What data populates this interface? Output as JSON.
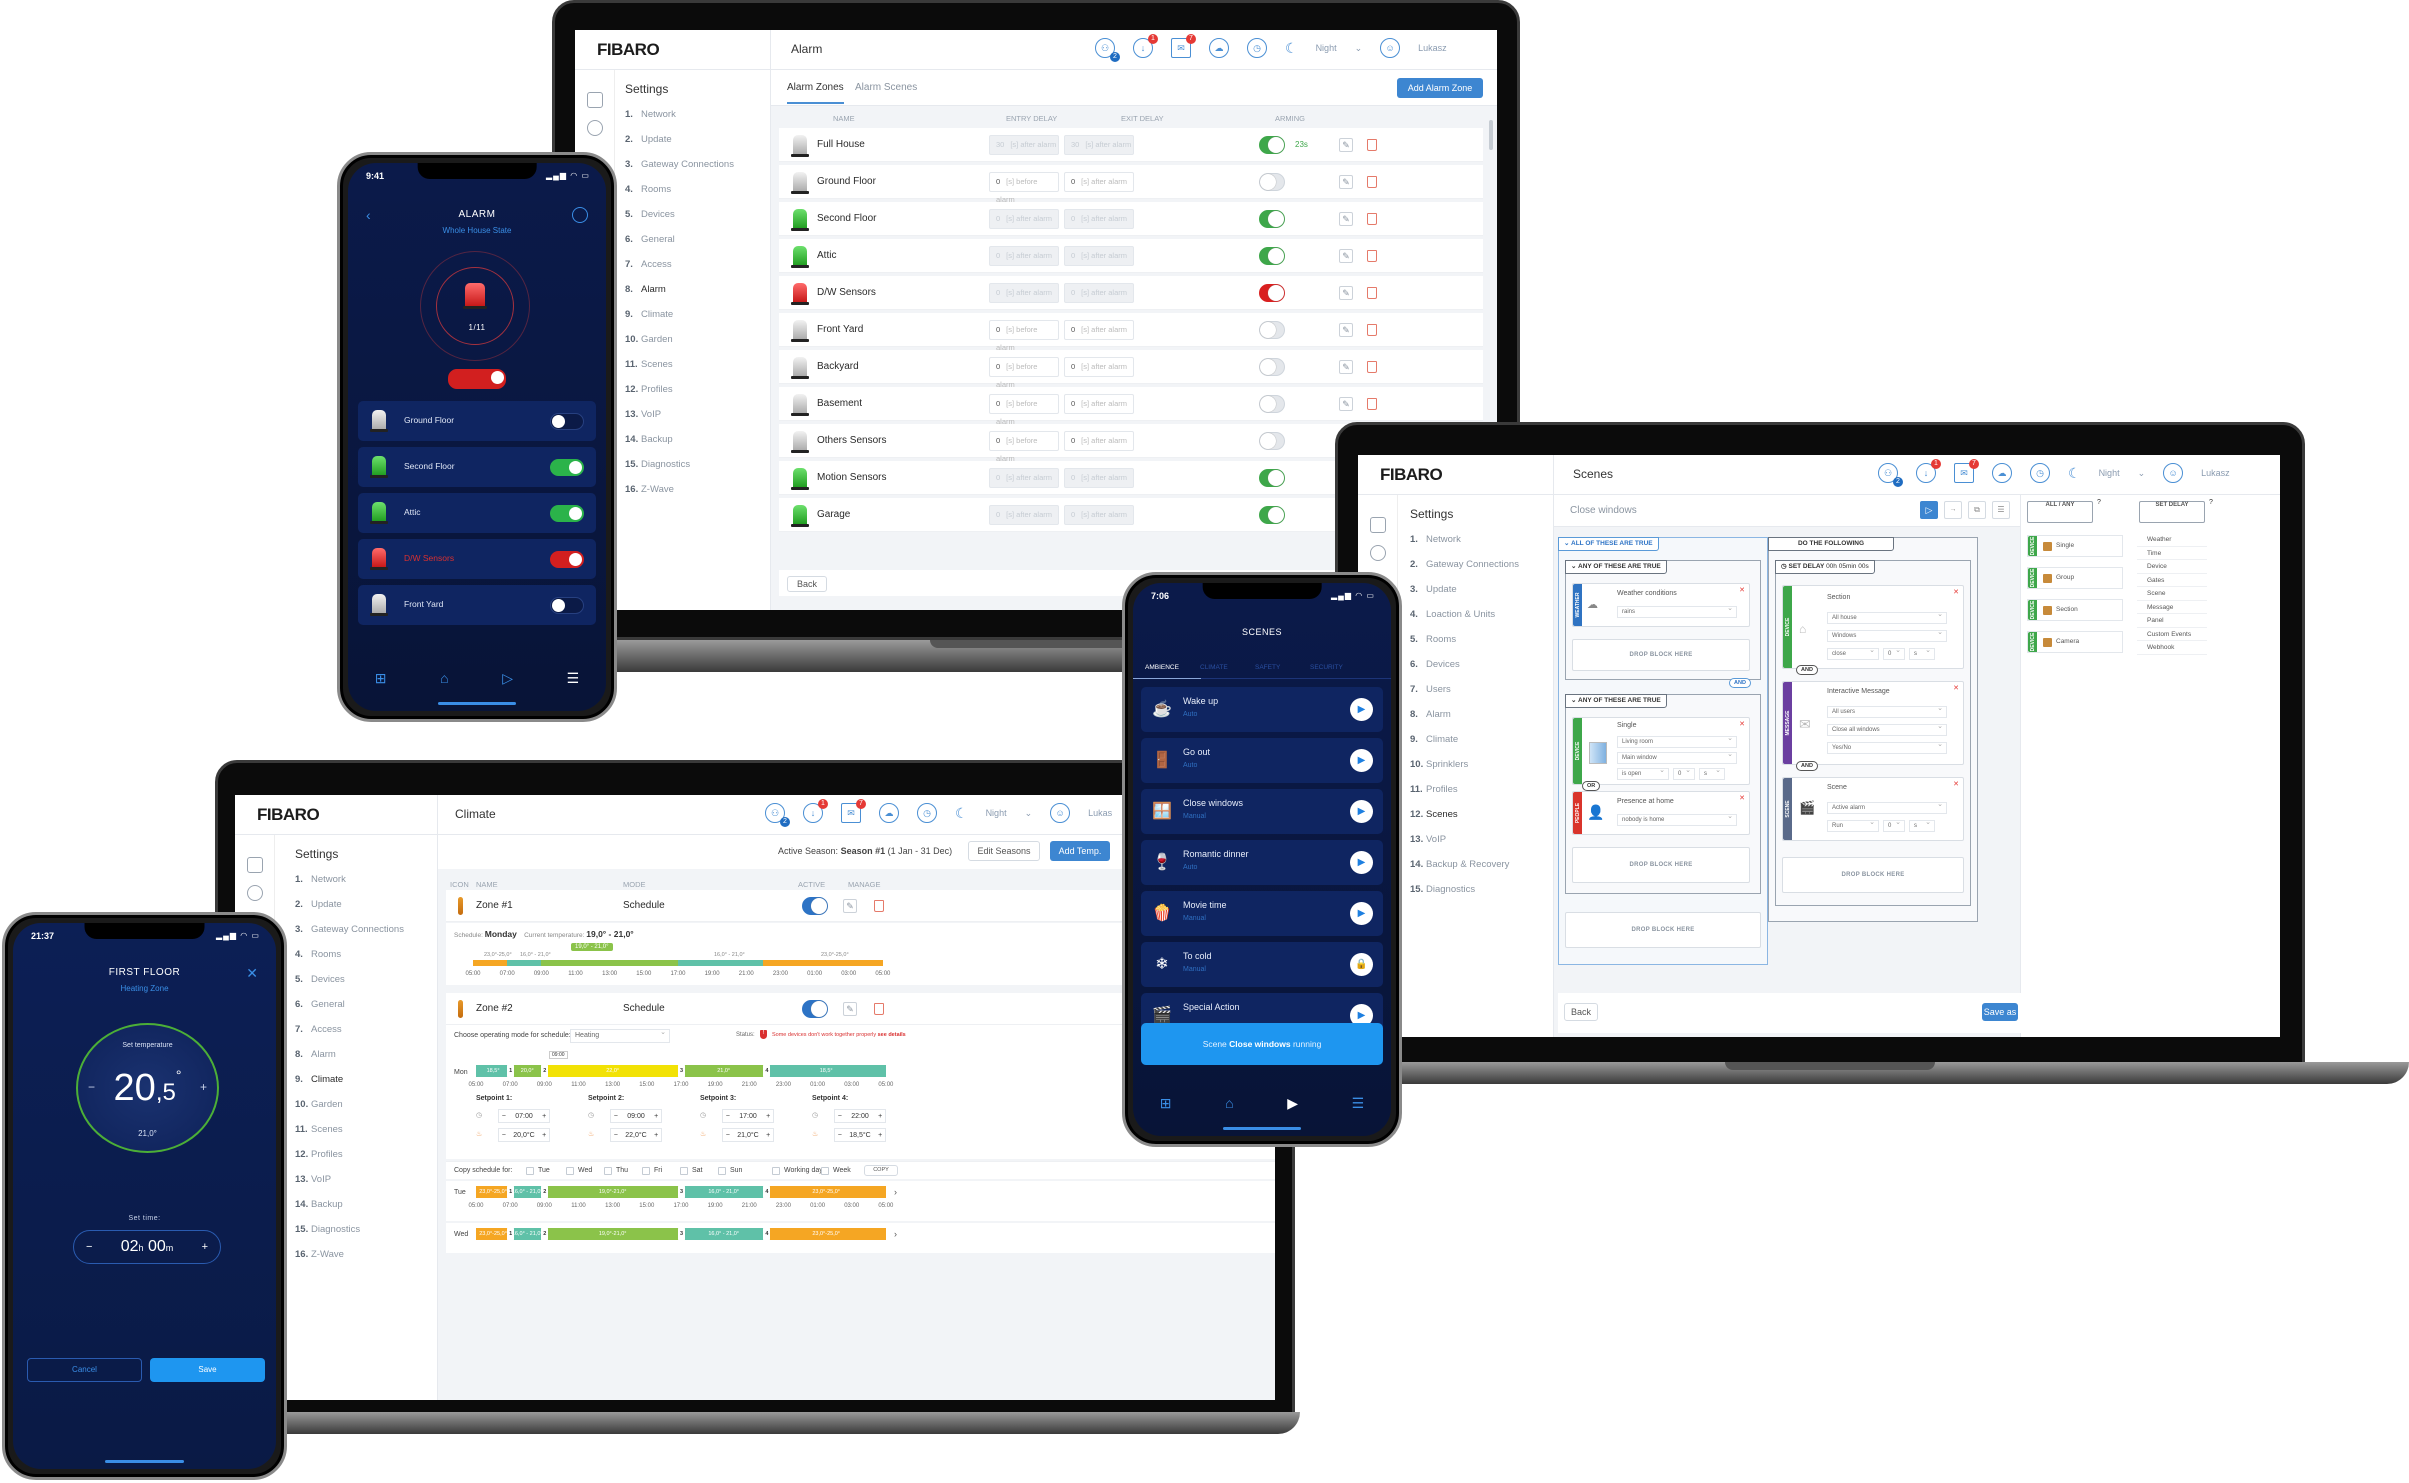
{
  "alarm_app": {
    "brand": "FIBARO",
    "page_title": "Alarm",
    "topbar": {
      "users_badge": "2",
      "updates_badge": "1",
      "messages_badge": "7",
      "mode_label": "Night",
      "user_name": "Lukasz"
    },
    "sidebar": {
      "title": "Settings",
      "items": [
        {
          "num": "1.",
          "label": "Network"
        },
        {
          "num": "2.",
          "label": "Update"
        },
        {
          "num": "3.",
          "label": "Gateway Connections"
        },
        {
          "num": "4.",
          "label": "Rooms"
        },
        {
          "num": "5.",
          "label": "Devices"
        },
        {
          "num": "6.",
          "label": "General"
        },
        {
          "num": "7.",
          "label": "Access"
        },
        {
          "num": "8.",
          "label": "Alarm",
          "active": true
        },
        {
          "num": "9.",
          "label": "Climate"
        },
        {
          "num": "10.",
          "label": "Garden"
        },
        {
          "num": "11.",
          "label": "Scenes"
        },
        {
          "num": "12.",
          "label": "Profiles"
        },
        {
          "num": "13.",
          "label": "VoIP"
        },
        {
          "num": "14.",
          "label": "Backup"
        },
        {
          "num": "15.",
          "label": "Diagnostics"
        },
        {
          "num": "16.",
          "label": "Z-Wave"
        }
      ]
    },
    "tabs": [
      "Alarm Zones",
      "Alarm Scenes"
    ],
    "add_button": "Add Alarm Zone",
    "columns": {
      "name": "NAME",
      "entry": "ENTRY DELAY",
      "exit": "EXIT DELAY",
      "arming": "ARMING"
    },
    "rows": [
      {
        "name": "Full House",
        "siren": "grey",
        "entry_value": "30",
        "entry_unit": "[s] after alarm",
        "exit_value": "30",
        "exit_unit": "[s] after alarm",
        "armed": "on",
        "disabled": true,
        "countdown": "23s"
      },
      {
        "name": "Ground Floor",
        "siren": "grey",
        "entry_value": "0",
        "entry_unit": "[s] before alarm",
        "exit_value": "0",
        "exit_unit": "[s] after alarm",
        "armed": "off",
        "disabled": false
      },
      {
        "name": "Second Floor",
        "siren": "green",
        "entry_value": "0",
        "entry_unit": "[s] after alarm",
        "exit_value": "0",
        "exit_unit": "[s] after alarm",
        "armed": "on",
        "disabled": true
      },
      {
        "name": "Attic",
        "siren": "green",
        "entry_value": "0",
        "entry_unit": "[s] after alarm",
        "exit_value": "0",
        "exit_unit": "[s] after alarm",
        "armed": "on",
        "disabled": true
      },
      {
        "name": "D/W Sensors",
        "siren": "red",
        "entry_value": "0",
        "entry_unit": "[s] after alarm",
        "exit_value": "0",
        "exit_unit": "[s] after alarm",
        "armed": "red",
        "disabled": true
      },
      {
        "name": "Front Yard",
        "siren": "grey",
        "entry_value": "0",
        "entry_unit": "[s] before alarm",
        "exit_value": "0",
        "exit_unit": "[s] after alarm",
        "armed": "off",
        "disabled": false
      },
      {
        "name": "Backyard",
        "siren": "grey",
        "entry_value": "0",
        "entry_unit": "[s] before alarm",
        "exit_value": "0",
        "exit_unit": "[s] after alarm",
        "armed": "off",
        "disabled": false
      },
      {
        "name": "Basement",
        "siren": "grey",
        "entry_value": "0",
        "entry_unit": "[s] before alarm",
        "exit_value": "0",
        "exit_unit": "[s] after alarm",
        "armed": "off",
        "disabled": false
      },
      {
        "name": "Others Sensors",
        "siren": "grey",
        "entry_value": "0",
        "entry_unit": "[s] before alarm",
        "exit_value": "0",
        "exit_unit": "[s] after alarm",
        "armed": "off",
        "disabled": false
      },
      {
        "name": "Motion Sensors",
        "siren": "green",
        "entry_value": "0",
        "entry_unit": "[s] after alarm",
        "exit_value": "0",
        "exit_unit": "[s] after alarm",
        "armed": "on",
        "disabled": true
      },
      {
        "name": "Garage",
        "siren": "green",
        "entry_value": "0",
        "entry_unit": "[s] after alarm",
        "exit_value": "0",
        "exit_unit": "[s] after alarm",
        "armed": "on",
        "disabled": true
      }
    ],
    "back_button": "Back"
  },
  "alarm_phone": {
    "time": "9:41",
    "title": "ALARM",
    "subtitle": "Whole House State",
    "state_count": "1/11",
    "zones": [
      {
        "name": "Ground Floor",
        "siren": "grey",
        "state": "off"
      },
      {
        "name": "Second Floor",
        "siren": "green",
        "state": "on"
      },
      {
        "name": "Attic",
        "siren": "green",
        "state": "on"
      },
      {
        "name": "D/W Sensors",
        "siren": "red",
        "state": "red"
      },
      {
        "name": "Front Yard",
        "siren": "grey",
        "state": "off"
      }
    ]
  },
  "scenes_app": {
    "brand": "FIBARO",
    "page_title": "Scenes",
    "topbar": {
      "users_badge": "2",
      "updates_badge": "1",
      "messages_badge": "7",
      "mode_label": "Night",
      "user_name": "Lukasz"
    },
    "sidebar": {
      "title": "Settings",
      "items": [
        {
          "num": "1.",
          "label": "Network"
        },
        {
          "num": "2.",
          "label": "Gateway Connections"
        },
        {
          "num": "3.",
          "label": "Update"
        },
        {
          "num": "4.",
          "label": "Loaction & Units"
        },
        {
          "num": "5.",
          "label": "Rooms"
        },
        {
          "num": "6.",
          "label": "Devices"
        },
        {
          "num": "7.",
          "label": "Users"
        },
        {
          "num": "8.",
          "label": "Alarm"
        },
        {
          "num": "9.",
          "label": "Climate"
        },
        {
          "num": "10.",
          "label": "Sprinklers"
        },
        {
          "num": "11.",
          "label": "Profiles"
        },
        {
          "num": "12.",
          "label": "Scenes",
          "active": true
        },
        {
          "num": "13.",
          "label": "VoIP"
        },
        {
          "num": "14.",
          "label": "Backup & Recovery"
        },
        {
          "num": "15.",
          "label": "Diagnostics"
        }
      ]
    },
    "scene_name": "Close windows",
    "conditions": {
      "header": "ALL OF THESE ARE TRUE",
      "group1_header": "ANY OF THESE ARE TRUE",
      "weather_strip": "WEATHER",
      "weather_title": "Weather conditions",
      "weather_value": "rains",
      "group2_header": "ANY OF THESE ARE TRUE",
      "device_strip": "DEVICE",
      "single_title": "Single",
      "single_room": "Living room",
      "single_device": "Main window",
      "single_state": "is open",
      "single_num": "0",
      "single_unit": "s",
      "people_strip": "PEOPLE",
      "presence_title": "Presence at home",
      "presence_value": "nobody is home",
      "or_label": "OR",
      "and_label": "AND",
      "drop_label": "DROP BLOCK HERE"
    },
    "actions": {
      "header": "DO THE FOLLOWING",
      "delay_label": "SET DELAY",
      "delay_value": "00h 05min 00s",
      "device_strip": "DEVICE",
      "section_title": "Section",
      "section_area": "All house",
      "section_device": "Windows",
      "section_action": "close",
      "section_num": "0",
      "section_unit": "s",
      "message_strip": "MESSAGE",
      "message_title": "Interactive Message",
      "message_to": "All users",
      "message_text": "Close all windows",
      "message_type": "Yes/No",
      "scene_strip": "SCENE",
      "scene_title": "Scene",
      "scene_target": "Active alarm",
      "scene_action": "Run",
      "scene_num": "0",
      "scene_unit": "s",
      "and_label": "AND",
      "drop_label": "DROP BLOCK HERE"
    },
    "palette": {
      "all_any": "ALL / ANY",
      "set_delay": "SET DELAY",
      "help": "?",
      "devices": [
        {
          "strip": "DEVICE",
          "label": "Single"
        },
        {
          "strip": "DEVICE",
          "label": "Group"
        },
        {
          "strip": "DEVICE",
          "label": "Section"
        },
        {
          "strip": "DEVICE",
          "label": "Camera"
        }
      ],
      "categories": [
        "Weather",
        "Time",
        "Device",
        "Gates",
        "Scene",
        "Message",
        "Panel",
        "Custom Events",
        "Webhook"
      ]
    },
    "back_button": "Back",
    "save_button": "Save as"
  },
  "scenes_phone": {
    "time": "7:06",
    "title": "SCENES",
    "tabs": [
      "AMBIENCE",
      "CLIMATE",
      "SAFETY",
      "SECURITY"
    ],
    "scenes": [
      {
        "name": "Wake up",
        "mode": "Auto",
        "icon": "☕",
        "action": "play"
      },
      {
        "name": "Go out",
        "mode": "Auto",
        "icon": "🚪",
        "action": "play"
      },
      {
        "name": "Close windows",
        "mode": "Manual",
        "icon": "🪟",
        "action": "play"
      },
      {
        "name": "Romantic dinner",
        "mode": "Auto",
        "icon": "🍷",
        "action": "play"
      },
      {
        "name": "Movie time",
        "mode": "Manual",
        "icon": "🍿",
        "action": "play"
      },
      {
        "name": "To cold",
        "mode": "Manual",
        "icon": "❄",
        "action": "lock"
      },
      {
        "name": "Special Action",
        "mode": "",
        "icon": "🎬",
        "action": "play"
      }
    ],
    "toast_prefix": "Scene",
    "toast_scene": "Close windows",
    "toast_suffix": "running"
  },
  "climate_app": {
    "brand": "FIBARO",
    "page_title": "Climate",
    "topbar": {
      "users_badge": "2",
      "updates_badge": "1",
      "messages_badge": "7",
      "mode_label": "Night",
      "user_name": "Lukas"
    },
    "sidebar": {
      "title": "Settings",
      "items": [
        {
          "num": "1.",
          "label": "Network"
        },
        {
          "num": "2.",
          "label": "Update"
        },
        {
          "num": "3.",
          "label": "Gateway Connections"
        },
        {
          "num": "4.",
          "label": "Rooms"
        },
        {
          "num": "5.",
          "label": "Devices"
        },
        {
          "num": "6.",
          "label": "General"
        },
        {
          "num": "7.",
          "label": "Access"
        },
        {
          "num": "8.",
          "label": "Alarm"
        },
        {
          "num": "9.",
          "label": "Climate",
          "active": true
        },
        {
          "num": "10.",
          "label": "Garden"
        },
        {
          "num": "11.",
          "label": "Scenes"
        },
        {
          "num": "12.",
          "label": "Profiles"
        },
        {
          "num": "13.",
          "label": "VoIP"
        },
        {
          "num": "14.",
          "label": "Backup"
        },
        {
          "num": "15.",
          "label": "Diagnostics"
        },
        {
          "num": "16.",
          "label": "Z-Wave"
        }
      ]
    },
    "active_season_label": "Active Season:",
    "active_season_value": "Season #1",
    "active_season_range": "(1 Jan - 31 Dec)",
    "edit_seasons": "Edit Seasons",
    "add_temp": "Add Temp.",
    "columns": {
      "icon": "ICON",
      "name": "NAME",
      "mode": "MODE",
      "active": "ACTIVE",
      "manage": "MANAGE"
    },
    "zone1": {
      "name": "Zone #1",
      "mode": "Schedule",
      "schedule_label": "Schedule:",
      "schedule_day": "Monday",
      "current_label": "Current temperature:",
      "current_value": "19,0° - 21,0°",
      "tooltip": "19,0° - 21,0°",
      "range_labels": [
        "23,0°-25,0°",
        "16,0° - 21,0°",
        "16,0° - 21,0°",
        "23,0°-25,0°"
      ]
    },
    "zone2": {
      "name": "Zone #2",
      "mode": "Schedule",
      "mode_prompt": "Choose operating mode for schedule:",
      "mode_value": "Heating",
      "status_label": "Status:",
      "status_text": "Some devices don't work together properly",
      "status_link": "see details",
      "drag_tooltip": "09:00",
      "day": "Mon",
      "setpoints": [
        {
          "label": "Setpoint 1:",
          "time": "07:00",
          "temp": "20,0°C"
        },
        {
          "label": "Setpoint 2:",
          "time": "09:00",
          "temp": "22,0°C"
        },
        {
          "label": "Setpoint 3:",
          "time": "17:00",
          "temp": "21,0°C"
        },
        {
          "label": "Setpoint 4:",
          "time": "22:00",
          "temp": "18,5°C"
        }
      ],
      "copy_label": "Copy schedule for:",
      "copy_days": [
        "Tue",
        "Wed",
        "Thu",
        "Fri",
        "Sat",
        "Sun",
        "Working days",
        "Week"
      ],
      "copy_button": "COPY"
    },
    "time_ticks": [
      "05:00",
      "07:00",
      "09:00",
      "11:00",
      "13:00",
      "15:00",
      "17:00",
      "19:00",
      "21:00",
      "23:00",
      "01:00",
      "03:00",
      "05:00"
    ],
    "schedules": {
      "zone1": [
        {
          "from": "05:00",
          "to": "07:00",
          "label": "",
          "color": "o"
        },
        {
          "from": "07:00",
          "to": "09:00",
          "label": "",
          "color": "t"
        },
        {
          "from": "09:00",
          "to": "17:00",
          "label": "",
          "color": "g"
        },
        {
          "from": "17:00",
          "to": "22:00",
          "label": "",
          "color": "t"
        },
        {
          "from": "22:00",
          "to": "05:00",
          "label": "",
          "color": "o"
        }
      ],
      "mon": [
        {
          "from": "05:00",
          "to": "07:00",
          "label": "18,5°",
          "color": "t"
        },
        {
          "from": "07:00",
          "to": "09:00",
          "label": "20,0°",
          "color": "g"
        },
        {
          "from": "09:00",
          "to": "17:00",
          "label": "22,0°",
          "color": "y"
        },
        {
          "from": "17:00",
          "to": "22:00",
          "label": "21,0°",
          "color": "g"
        },
        {
          "from": "22:00",
          "to": "05:00",
          "label": "18,5°",
          "color": "t"
        }
      ],
      "tue": [
        {
          "from": "05:00",
          "to": "07:00",
          "label": "23,0°-25,0°",
          "color": "o"
        },
        {
          "from": "07:00",
          "to": "09:00",
          "label": "16,0° - 21,0°",
          "color": "t"
        },
        {
          "from": "09:00",
          "to": "17:00",
          "label": "19,0°-21,0°",
          "color": "g"
        },
        {
          "from": "17:00",
          "to": "22:00",
          "label": "16,0° - 21,0°",
          "color": "t"
        },
        {
          "from": "22:00",
          "to": "05:00",
          "label": "23,0°-25,0°",
          "color": "o"
        }
      ],
      "wed": [
        {
          "from": "05:00",
          "to": "07:00",
          "label": "23,0°-25,0°",
          "color": "o"
        },
        {
          "from": "07:00",
          "to": "09:00",
          "label": "16,0° - 21,0°",
          "color": "t"
        },
        {
          "from": "09:00",
          "to": "17:00",
          "label": "19,0°-21,0°",
          "color": "g"
        },
        {
          "from": "17:00",
          "to": "22:00",
          "label": "16,0° - 21,0°",
          "color": "t"
        },
        {
          "from": "22:00",
          "to": "05:00",
          "label": "23,0°-25,0°",
          "color": "o"
        }
      ]
    },
    "day_labels": {
      "tue": "Tue",
      "wed": "Wed"
    }
  },
  "climate_phone": {
    "time": "21:37",
    "title": "FIRST FLOOR",
    "subtitle": "Heating Zone",
    "set_temp_label": "Set temperature",
    "set_temp_int": "20",
    "set_temp_dec": ",5",
    "degree": "°",
    "current_temp": "21,0°",
    "set_time_label": "Set time:",
    "hours": "02",
    "hours_unit": "h",
    "minutes": "00",
    "minutes_unit": "m",
    "minus": "−",
    "plus": "+",
    "cancel": "Cancel",
    "save": "Save"
  }
}
